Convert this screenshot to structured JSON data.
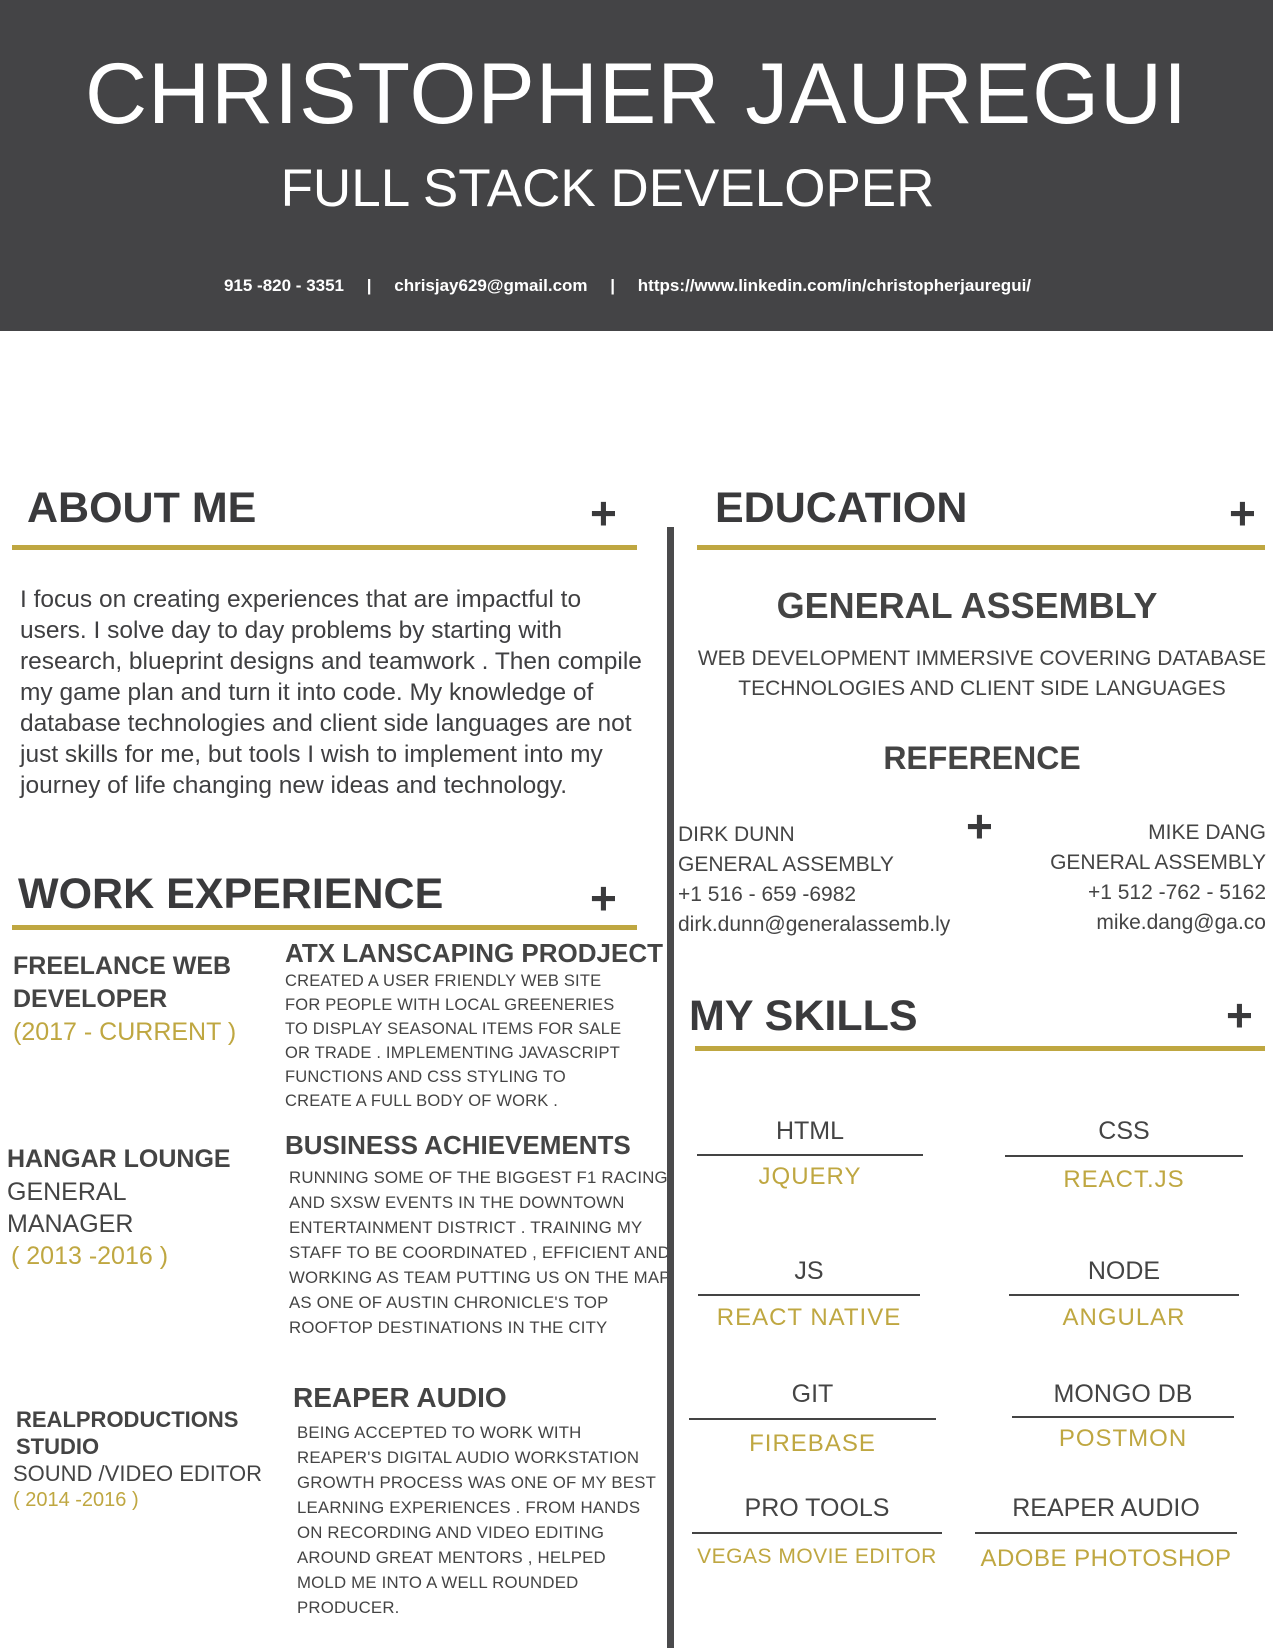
{
  "header": {
    "name": "CHRISTOPHER JAUREGUI",
    "role": "FULL STACK DEVELOPER",
    "phone": "915 -820 - 3351",
    "separator": "|",
    "email": "chrisjay629@gmail.com",
    "linkedin": "https://www.linkedin.com/in/christopherjauregui/"
  },
  "plus_symbol": "+",
  "about": {
    "title": "ABOUT ME",
    "lines": [
      "I focus on creating  experiences that are impactful to",
      "users. I solve day to day problems by starting  with",
      "research, blueprint designs and teamwork . Then compile",
      " my game plan and turn it into code.  My knowledge of",
      "database technologies and client side languages are not",
      "just skills for me, but  tools I wish to implement into my",
      "journey of life changing new ideas and technology."
    ]
  },
  "work": {
    "title": "WORK EXPERIENCE",
    "jobs": [
      {
        "title_lines": [
          "FREELANCE WEB",
          "DEVELOPER"
        ],
        "subtitle_lines": [],
        "dates": "(2017 - CURRENT )",
        "project_title": "ATX LANSCAPING PRODJECT",
        "desc_lines": [
          "CREATED A USER FRIENDLY WEB SITE",
          "FOR PEOPLE WITH LOCAL GREENERIES",
          "TO DISPLAY SEASONAL ITEMS FOR SALE",
          "OR TRADE . IMPLEMENTING JAVASCRIPT",
          "FUNCTIONS AND CSS STYLING TO",
          "CREATE A FULL BODY OF WORK ."
        ]
      },
      {
        "title_lines": [
          "HANGAR LOUNGE"
        ],
        "subtitle_lines": [
          "GENERAL",
          "MANAGER"
        ],
        "dates": "( 2013 -2016 )",
        "project_title": "BUSINESS ACHIEVEMENTS",
        "desc_lines": [
          "RUNNING SOME OF THE BIGGEST F1 RACING",
          "AND SXSW EVENTS IN THE DOWNTOWN",
          "ENTERTAINMENT DISTRICT . TRAINING MY",
          "STAFF TO BE COORDINATED , EFFICIENT AND",
          "WORKING AS TEAM PUTTING US ON THE MAP",
          "AS ONE OF  AUSTIN CHRONICLE'S TOP",
          " ROOFTOP DESTINATIONS IN THE CITY"
        ]
      },
      {
        "title_lines": [
          "REALPRODUCTIONS",
          "STUDIO"
        ],
        "subtitle_lines": [
          "SOUND /VIDEO EDITOR"
        ],
        "dates": "( 2014 -2016 )",
        "project_title": "REAPER AUDIO",
        "desc_lines": [
          "BEING ACCEPTED TO WORK WITH",
          "REAPER'S DIGITAL AUDIO WORKSTATION",
          "GROWTH PROCESS WAS ONE OF MY BEST",
          "LEARNING EXPERIENCES . FROM HANDS",
          "ON RECORDING AND VIDEO EDITING",
          "AROUND GREAT MENTORS , HELPED",
          "MOLD ME INTO A WELL ROUNDED",
          "PRODUCER."
        ]
      }
    ]
  },
  "education": {
    "title": "EDUCATION",
    "school": "GENERAL ASSEMBLY",
    "desc_lines": [
      "WEB DEVELOPMENT IMMERSIVE COVERING DATABASE",
      "TECHNOLOGIES AND CLIENT SIDE LANGUAGES"
    ]
  },
  "reference": {
    "title": "REFERENCE",
    "people": [
      {
        "name": "DIRK DUNN",
        "org": "GENERAL ASSEMBLY",
        "phone": "+1 516 - 659 -6982",
        "email": "dirk.dunn@generalassemb.ly"
      },
      {
        "name": "MIKE DANG",
        "org": "GENERAL ASSEMBLY",
        "phone": "+1 512 -762 - 5162",
        "email": "mike.dang@ga.co"
      }
    ]
  },
  "skills": {
    "title": "MY SKILLS",
    "items": [
      {
        "name": "HTML",
        "sub": "JQUERY"
      },
      {
        "name": "CSS",
        "sub": "REACT.JS"
      },
      {
        "name": "JS",
        "sub": "REACT NATIVE"
      },
      {
        "name": "NODE",
        "sub": "ANGULAR"
      },
      {
        "name": "GIT",
        "sub": "FIREBASE"
      },
      {
        "name": "MONGO DB",
        "sub": "POSTMON"
      },
      {
        "name": "PRO TOOLS",
        "sub": "VEGAS MOVIE EDITOR"
      },
      {
        "name": "REAPER AUDIO",
        "sub": "ADOBE PHOTOSHOP"
      }
    ]
  },
  "colors": {
    "header_bg": "#444446",
    "accent": "#bfa741",
    "text": "#444444"
  }
}
